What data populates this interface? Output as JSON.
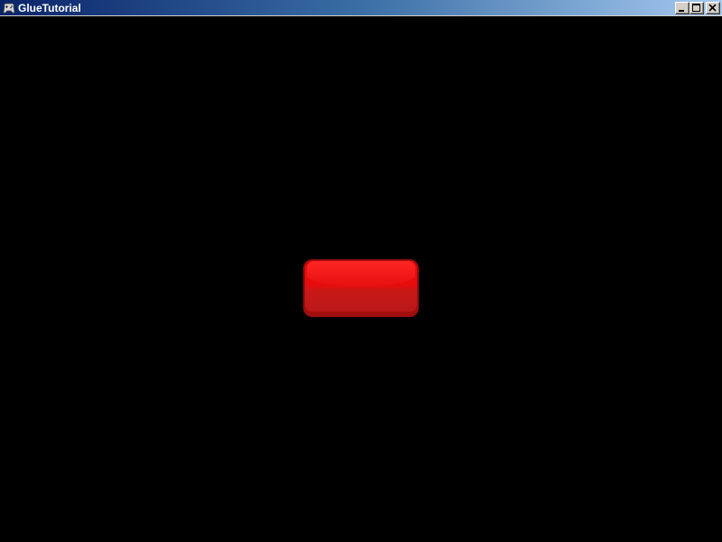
{
  "window": {
    "title": "GlueTutorial",
    "app_icon": "gamepad-icon",
    "controls": [
      {
        "name": "minimize",
        "icon": "minimize-icon"
      },
      {
        "name": "maximize",
        "icon": "maximize-icon"
      },
      {
        "name": "close",
        "icon": "close-icon"
      }
    ]
  },
  "content": {
    "background_color": "#000000",
    "button": {
      "label": "",
      "color": "#e60c0c",
      "border_color": "#9a0d0d"
    }
  }
}
